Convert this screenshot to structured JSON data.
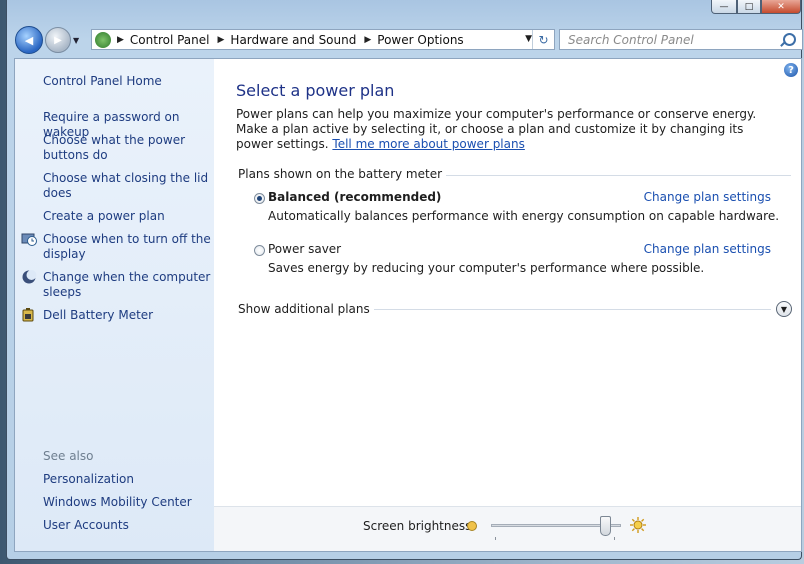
{
  "window": {
    "caption": {
      "minimize": "—",
      "maximize": "□",
      "close": "✕"
    }
  },
  "nav": {
    "back_glyph": "◀",
    "forward_glyph": "▶",
    "recent_glyph": "▼"
  },
  "address": {
    "crumbs": [
      "Control Panel",
      "Hardware and Sound",
      "Power Options"
    ],
    "separator": "▶",
    "dropdown_glyph": "▼",
    "refresh_glyph": "↻"
  },
  "search": {
    "placeholder": "Search Control Panel"
  },
  "sidebar": {
    "home": "Control Panel Home",
    "links": [
      "Require a password on wakeup",
      "Choose what the power buttons do",
      "Choose what closing the lid does",
      "Create a power plan",
      "Choose when to turn off the display",
      "Change when the computer sleeps",
      "Dell Battery Meter"
    ],
    "see_also_label": "See also",
    "see_also": [
      "Personalization",
      "Windows Mobility Center",
      "User Accounts"
    ]
  },
  "main": {
    "help_glyph": "?",
    "title": "Select a power plan",
    "intro": "Power plans can help you maximize your computer's performance or conserve energy. Make a plan active by selecting it, or choose a plan and customize it by changing its power settings.",
    "intro_link": "Tell me more about power plans",
    "group_header": "Plans shown on the battery meter",
    "plans": [
      {
        "name": "Balanced (recommended)",
        "description": "Automatically balances performance with energy consumption on capable hardware.",
        "action": "Change plan settings",
        "selected": true
      },
      {
        "name": "Power saver",
        "description": "Saves energy by reducing your computer's performance where possible.",
        "action": "Change plan settings",
        "selected": false
      }
    ],
    "additional": "Show additional plans",
    "expand_glyph": "▼"
  },
  "footer": {
    "brightness_label": "Screen brightness:",
    "brightness_level": 0.92
  }
}
